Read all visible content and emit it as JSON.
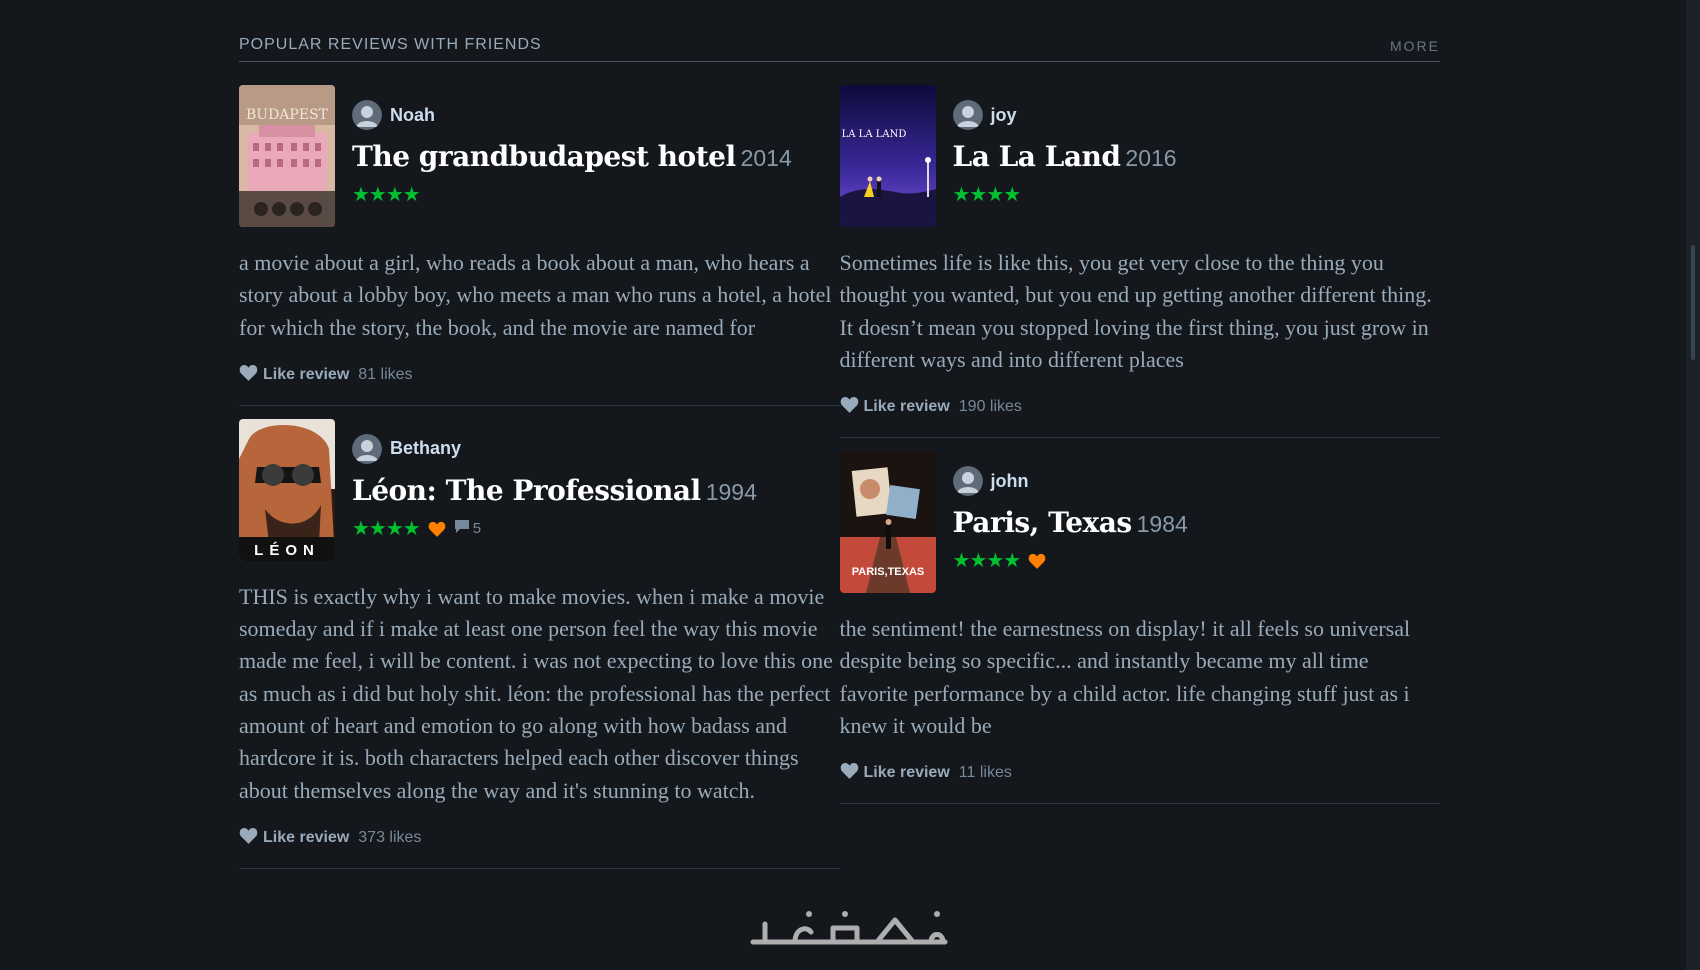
{
  "section": {
    "title": "POPULAR REVIEWS WITH FRIENDS",
    "more_label": "MORE"
  },
  "reviews": [
    {
      "user": "Noah",
      "film_title": "The grandbudapest hotel",
      "year": "2014",
      "stars": "★★★★",
      "liked": false,
      "comments": "",
      "text": "a movie about a girl, who reads a book about a man, who hears a story about a lobby boy, who meets a man who runs a hotel, a hotel for which the story, the book, and the movie are named for",
      "like_label": "Like review",
      "likes": "81 likes",
      "poster_text": "BUDAPEST"
    },
    {
      "user": "Bethany",
      "film_title": "Léon: The Professional",
      "year": "1994",
      "stars": "★★★★",
      "liked": true,
      "comments": "5",
      "text": "THIS is exactly why i want to make movies. when i make a movie someday and if i make at least one person feel the way this movie made me feel, i will be content. i was not expecting to love this one as much as i did but holy shit. léon: the professional has the perfect amount of heart and emotion to go along with how badass and hardcore it is. both characters helped each other discover things about themselves along the way and it's stunning to watch.",
      "like_label": "Like review",
      "likes": "373 likes",
      "poster_text": "LÉON"
    },
    {
      "user": "joy",
      "film_title": "La La Land",
      "year": "2016",
      "stars": "★★★★",
      "liked": false,
      "comments": "",
      "text": "Sometimes life is like this, you get very close to the thing you thought you wanted, but you end up getting another different thing. It doesn’t mean you stopped loving the first thing, you just grow in different ways and into different places",
      "like_label": "Like review",
      "likes": "190 likes",
      "poster_text": "LA LA LAND"
    },
    {
      "user": "john",
      "film_title": "Paris, Texas",
      "year": "1984",
      "stars": "★★★★",
      "liked": true,
      "comments": "",
      "text": "the sentiment! the earnestness on display! it all feels so universal despite being so specific... and instantly became my all time favorite performance by a child actor. life changing stuff just as i knew it would be",
      "like_label": "Like review",
      "likes": "11 likes",
      "poster_text": "PARIS,TEXAS"
    }
  ],
  "watermark": "خمسات",
  "colors": {
    "background": "#14181c",
    "star_green": "#00c030",
    "heart_orange": "#ff8000",
    "title_white": "#ffffff",
    "body_text": "#99aabb"
  }
}
